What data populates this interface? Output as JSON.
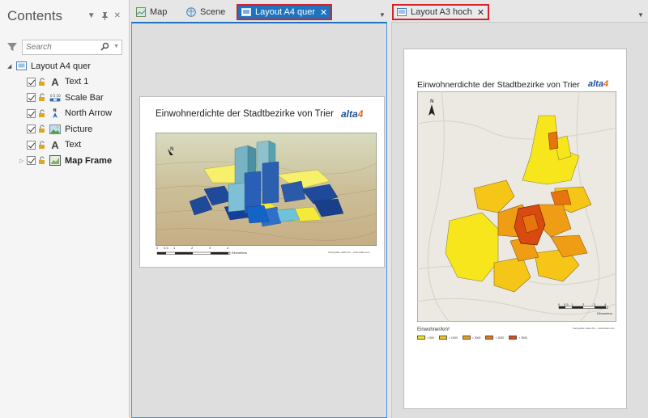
{
  "contents": {
    "title": "Contents",
    "search_placeholder": "Search",
    "root_item": "Layout A4 quer",
    "items": [
      {
        "label": "Text 1",
        "icon": "text-icon"
      },
      {
        "label": "Scale Bar",
        "icon": "scale-bar-icon"
      },
      {
        "label": "North Arrow",
        "icon": "north-arrow-icon"
      },
      {
        "label": "Picture",
        "icon": "picture-icon"
      },
      {
        "label": "Text",
        "icon": "text-icon"
      },
      {
        "label": "Map Frame",
        "icon": "map-frame-icon"
      }
    ]
  },
  "tabs": {
    "map": "Map",
    "scene": "Scene",
    "layout_a4": "Layout A4 quer",
    "layout_a3": "Layout A3 hoch",
    "close": "✕"
  },
  "layout_a4": {
    "title": "Einwohnerdichte der Stadtbezirke von Trier",
    "logo": "alta",
    "logo_suffix": "4",
    "scale_ticks": [
      "0",
      "0.5",
      "1",
      "2",
      "3",
      "4"
    ],
    "scale_unit": "Kilometers",
    "credit": "Kartografie: alta4 AG – www.alta4.com"
  },
  "layout_a3": {
    "title": "Einwohnerdichte der Stadtbezirke von Trier",
    "logo": "alta",
    "logo_suffix": "4",
    "scale_ticks": [
      "0",
      "0.5",
      "1",
      "2",
      "3",
      "4"
    ],
    "scale_unit": "Kilometers",
    "credit": "Kartografie: alta4 AG – www.alta4.com",
    "legend_title": "Einwohner/km²",
    "legend": [
      {
        "label": "< 500",
        "color": "#f7e61c"
      },
      {
        "label": "< 1000",
        "color": "#f5c518"
      },
      {
        "label": "< 2000",
        "color": "#ef9d14"
      },
      {
        "label": "< 3000",
        "color": "#e8740f"
      },
      {
        "label": "> 3000",
        "color": "#d94a0e"
      }
    ]
  },
  "colors": {
    "accent": "#1e73be",
    "highlight": "#d5222b"
  }
}
